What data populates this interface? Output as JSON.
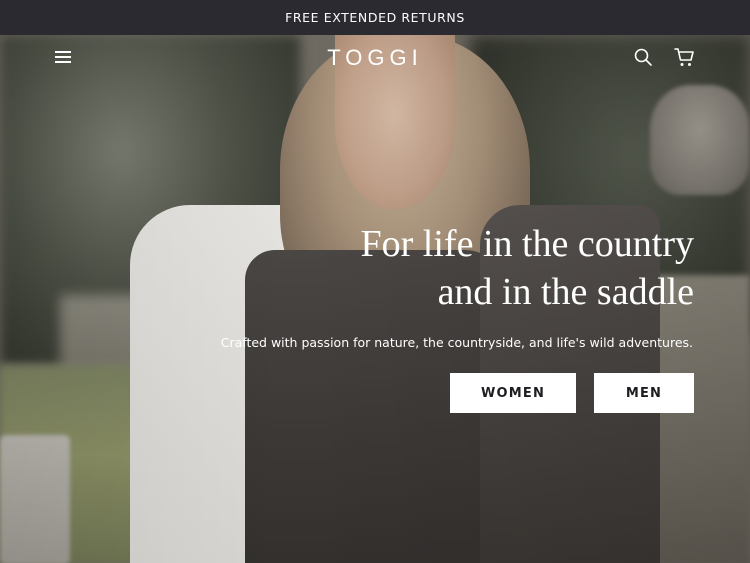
{
  "announcement": {
    "text": "FREE EXTENDED RETURNS"
  },
  "header": {
    "logo": "TOGGI",
    "icons": {
      "menu": "hamburger-menu-icon",
      "search": "search-icon",
      "cart": "cart-icon"
    }
  },
  "hero": {
    "headline_line1": "For life in the country",
    "headline_line2": "and in the saddle",
    "subheading": "Crafted with passion for nature, the countryside, and life's wild adventures.",
    "buttons": {
      "women": "WOMEN",
      "men": "MEN"
    }
  },
  "colors": {
    "announcement_bg": "#2a2a30",
    "text_on_hero": "#ffffff",
    "button_bg": "#ffffff",
    "button_text": "#1e1e22"
  }
}
